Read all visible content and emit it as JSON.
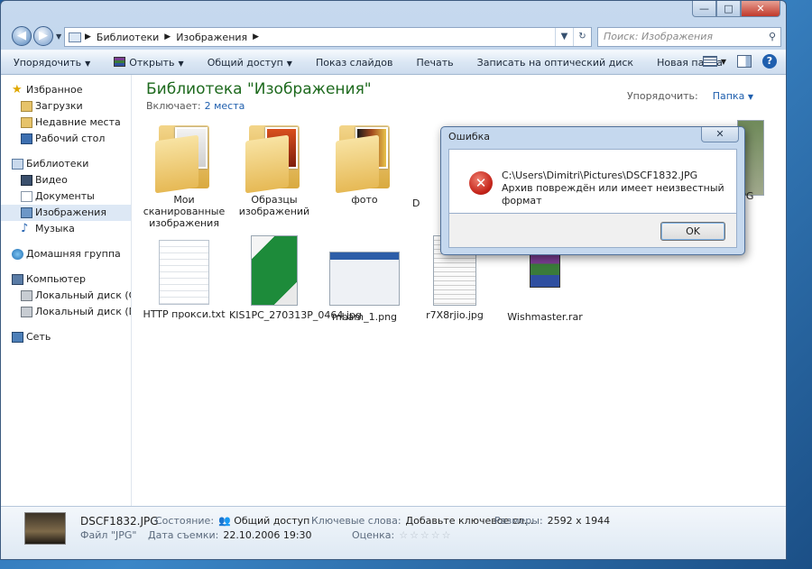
{
  "window": {
    "caption_buttons": [
      "—",
      "□",
      "✕"
    ]
  },
  "address": {
    "crumbs": [
      "Библиотеки",
      "Изображения"
    ],
    "search_placeholder": "Поиск: Изображения"
  },
  "toolbar": {
    "organize": "Упорядочить",
    "open": "Открыть",
    "share": "Общий доступ",
    "slideshow": "Показ слайдов",
    "print": "Печать",
    "burn": "Записать на оптический диск",
    "new_folder": "Новая папка"
  },
  "sidebar": {
    "favorites": "Избранное",
    "downloads": "Загрузки",
    "recent": "Недавние места",
    "desktop": "Рабочий стол",
    "libraries": "Библиотеки",
    "video": "Видео",
    "documents": "Документы",
    "images": "Изображения",
    "music": "Музыка",
    "homegroup": "Домашняя группа",
    "computer": "Компьютер",
    "disk_c": "Локальный диск (C:)",
    "disk_d": "Локальный диск (D:)",
    "network": "Сеть"
  },
  "library": {
    "title": "Библиотека \"Изображения\"",
    "includes_label": "Включает:",
    "includes_link": "2 места",
    "arrange_label": "Упорядочить:",
    "arrange_value": "Папка"
  },
  "files": {
    "f1": "Мои сканированные изображения",
    "f2": "Образцы изображений",
    "f3": "фото",
    "f4": "D",
    "f5": "JPG",
    "f6": "HTTP прокси.txt",
    "f7": "KIS1PC_270313P_0464.jpg",
    "f8": "mbam_1.png",
    "f9": "r7X8rjio.jpg",
    "f10": "Wishmaster.rar"
  },
  "dialog": {
    "title": "Ошибка",
    "path": "C:\\Users\\Dimitri\\Pictures\\DSCF1832.JPG",
    "message": "Архив повреждён или имеет неизвестный формат",
    "ok": "OK"
  },
  "details": {
    "filename": "DSCF1832.JPG",
    "filetype": "Файл \"JPG\"",
    "state_label": "Состояние:",
    "state_value": "Общий доступ",
    "date_label": "Дата съемки:",
    "date_value": "22.10.2006 19:30",
    "keywords_label": "Ключевые слова:",
    "keywords_value": "Добавьте ключевое сл...",
    "size_label": "Размеры:",
    "size_value": "2592 x 1944",
    "rating_label": "Оценка:",
    "rating_stars": "☆☆☆☆☆"
  },
  "colors": {
    "library_title": "#1e6a1e",
    "link": "#1f5fae",
    "error_red": "#c4241a"
  }
}
